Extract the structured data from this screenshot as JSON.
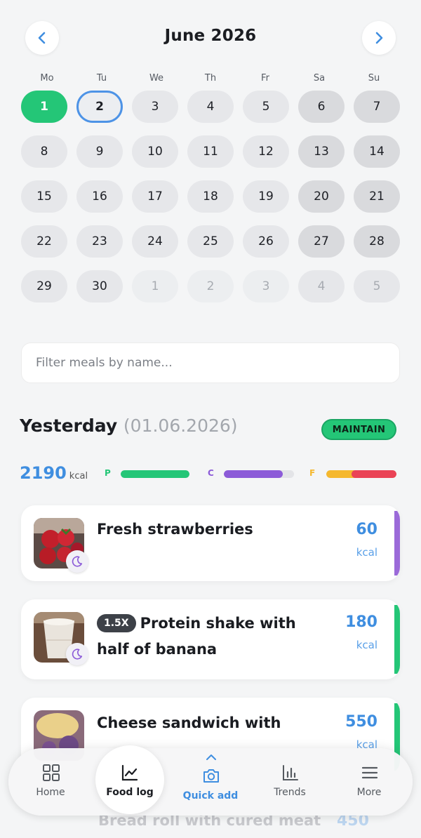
{
  "calendar": {
    "month_title": "June 2026",
    "weekdays": [
      "Mo",
      "Tu",
      "We",
      "Th",
      "Fr",
      "Sa",
      "Su"
    ],
    "weeks": [
      [
        "1",
        "2",
        "3",
        "4",
        "5",
        "6",
        "7"
      ],
      [
        "8",
        "9",
        "10",
        "11",
        "12",
        "13",
        "14"
      ],
      [
        "15",
        "16",
        "17",
        "18",
        "19",
        "20",
        "21"
      ],
      [
        "22",
        "23",
        "24",
        "25",
        "26",
        "27",
        "28"
      ],
      [
        "29",
        "30",
        "1",
        "2",
        "3",
        "4",
        "5"
      ]
    ],
    "selected_day": "1",
    "today_day": "2",
    "prev_icon": "chevron-left-icon",
    "next_icon": "chevron-right-icon"
  },
  "search": {
    "placeholder": "Filter meals by name..."
  },
  "day_summary": {
    "label": "Yesterday",
    "date": "(01.06.2026)",
    "goal_badge": "MAINTAIN",
    "kcal": "2190",
    "kcal_unit": "kcal",
    "macros": [
      {
        "letter": "P",
        "color": "#24c677",
        "fill": 1.0
      },
      {
        "letter": "C",
        "color": "#8c5bd8",
        "fill": 0.84
      },
      {
        "letter": "F",
        "color": "#f5b82e",
        "overflow_color": "#ea4356",
        "fill": 1.0,
        "overflow": 0.64
      }
    ]
  },
  "meals": [
    {
      "name": "Fresh strawberries",
      "multiplier": "",
      "kcal": "60",
      "unit": "kcal",
      "strip_color": "#9b6ad9",
      "icon": "moon-icon"
    },
    {
      "name": "Protein shake with half of banana",
      "multiplier": "1.5X",
      "kcal": "180",
      "unit": "kcal",
      "strip_color": "#24c677",
      "icon": "moon-icon"
    },
    {
      "name": "Cheese sandwich with",
      "multiplier": "",
      "kcal": "550",
      "unit": "kcal",
      "strip_color": "#24c677",
      "icon": "moon-icon"
    }
  ],
  "peek_meal": {
    "name": "Bread roll with cured meat",
    "kcal": "450"
  },
  "nav": {
    "items": [
      {
        "label": "Home",
        "icon": "grid-icon"
      },
      {
        "label": "Food log",
        "icon": "chart-line-icon"
      },
      {
        "label": "Quick add",
        "icon": "camera-icon"
      },
      {
        "label": "Trends",
        "icon": "bar-chart-icon"
      },
      {
        "label": "More",
        "icon": "menu-icon"
      }
    ],
    "active": "Food log"
  },
  "colors": {
    "accent_green": "#24c677",
    "accent_blue": "#3f8ee0",
    "today_ring": "#4d93e6"
  }
}
